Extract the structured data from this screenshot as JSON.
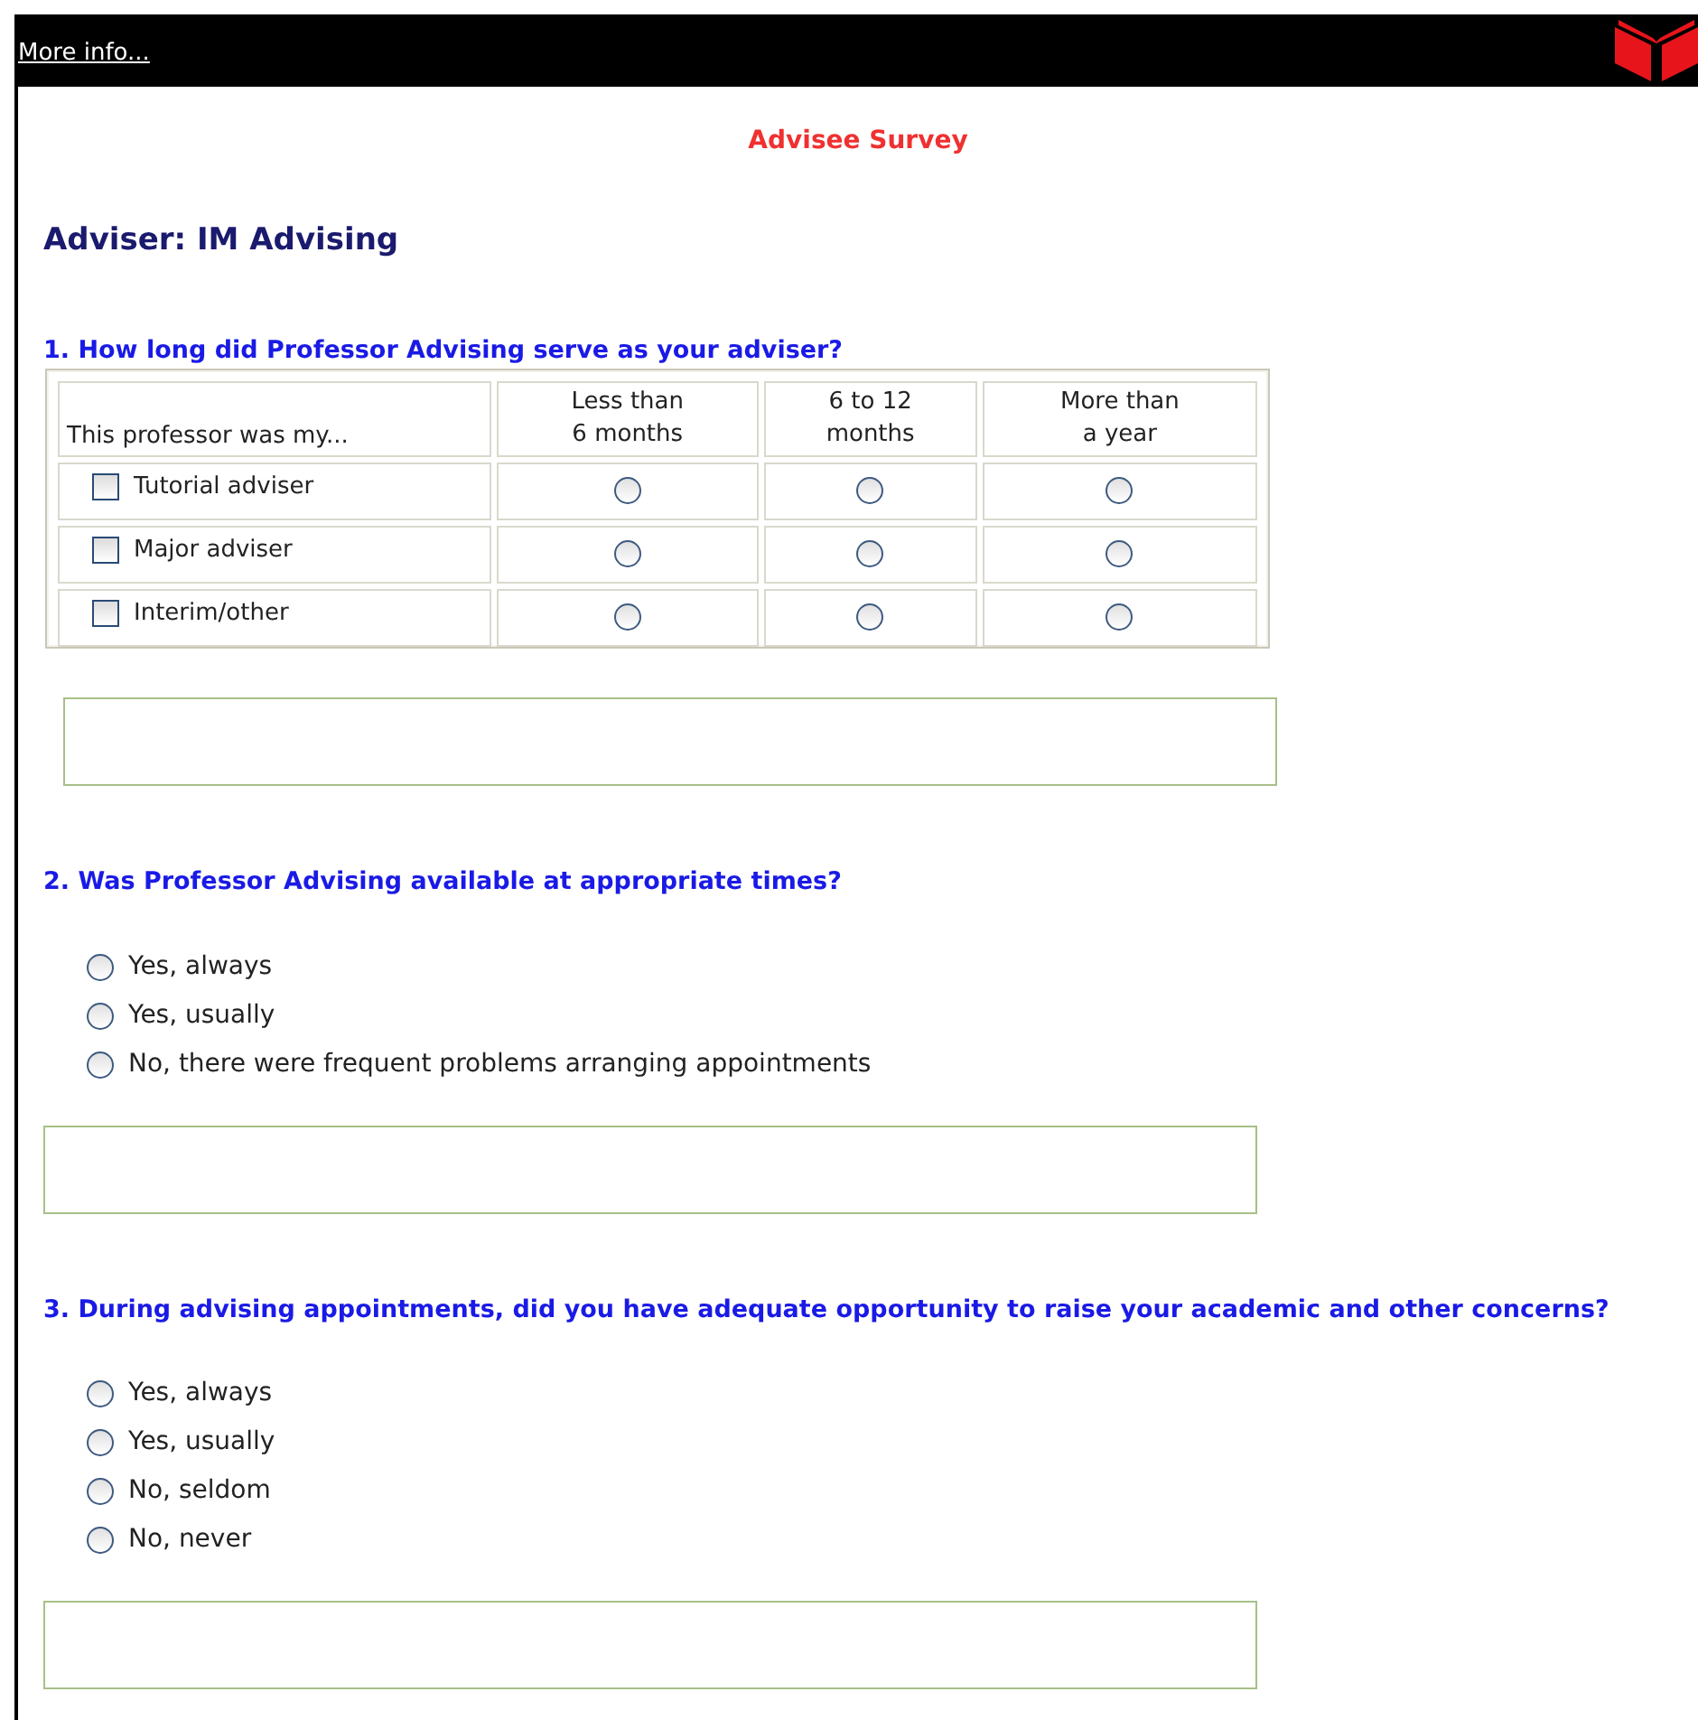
{
  "header": {
    "link": "More info..."
  },
  "title": "Advisee Survey",
  "adviser": "Adviser: IM Advising",
  "questions": [
    {
      "kind": "matrix",
      "text": "1. How long did Professor Advising serve as your adviser?",
      "corner": "This professor was my...",
      "columns": [
        "Less than\n6 months",
        "6 to 12\nmonths",
        "More than\na year"
      ],
      "rows": [
        {
          "label": "Tutorial adviser",
          "checked": false,
          "choices": [
            false,
            false,
            false
          ]
        },
        {
          "label": "Major adviser",
          "checked": false,
          "choices": [
            false,
            false,
            false
          ]
        },
        {
          "label": "Interim/other",
          "checked": false,
          "choices": [
            false,
            false,
            false
          ]
        }
      ]
    },
    {
      "kind": "choice",
      "text": "2. Was Professor Advising available at appropriate times?",
      "options": [
        {
          "label": "Yes, always",
          "selected": false
        },
        {
          "label": "Yes, usually",
          "selected": false
        },
        {
          "label": "No, there were frequent problems arranging appointments",
          "selected": false
        }
      ]
    },
    {
      "kind": "choice",
      "text": "3. During advising appointments, did you have adequate opportunity to raise your academic and other concerns?",
      "options": [
        {
          "label": "Yes, always",
          "selected": false
        },
        {
          "label": "Yes, usually",
          "selected": false
        },
        {
          "label": "No, seldom",
          "selected": false
        },
        {
          "label": "No, never",
          "selected": false
        }
      ]
    }
  ]
}
